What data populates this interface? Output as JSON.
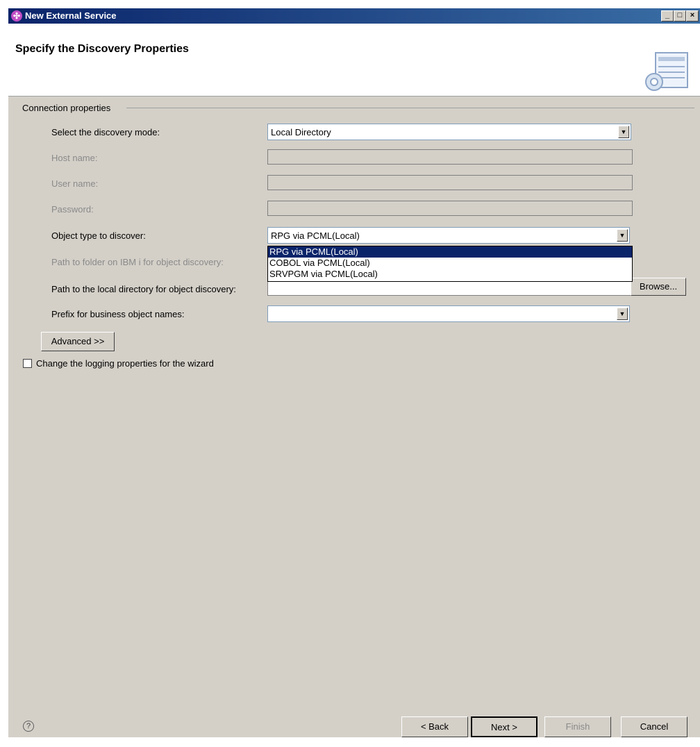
{
  "window": {
    "title": "New External Service",
    "page_title": "Specify the Discovery Properties",
    "icons": {
      "app": "external-service-icon",
      "banner": "discovery-wizard-banner-icon"
    }
  },
  "connection": {
    "group_label": "Connection properties",
    "discovery_mode": {
      "label": "Select the discovery mode:",
      "value": "Local Directory"
    },
    "host_name": {
      "label": "Host name:",
      "value": ""
    },
    "user_name": {
      "label": "User name:",
      "value": ""
    },
    "password": {
      "label": "Password:",
      "value": ""
    },
    "object_type": {
      "label": "Object type to discover:",
      "value": "RPG via PCML(Local)",
      "options": [
        "RPG via PCML(Local)",
        "COBOL via PCML(Local)",
        "SRVPGM via PCML(Local)"
      ],
      "selected_index": 0
    },
    "ibm_path": {
      "label": "Path to folder on IBM i for object discovery:"
    },
    "local_path": {
      "label": "Path to the local directory for object discovery:",
      "value": "",
      "browse_label": "Browse..."
    },
    "prefix": {
      "label": "Prefix for business object names:",
      "value": ""
    },
    "advanced_label": "Advanced >>"
  },
  "logging": {
    "label": "Change the logging properties for the wizard",
    "checked": false
  },
  "footer": {
    "help_symbol": "?",
    "back_label": "< Back",
    "next_label": "Next >",
    "finish_label": "Finish",
    "cancel_label": "Cancel"
  }
}
